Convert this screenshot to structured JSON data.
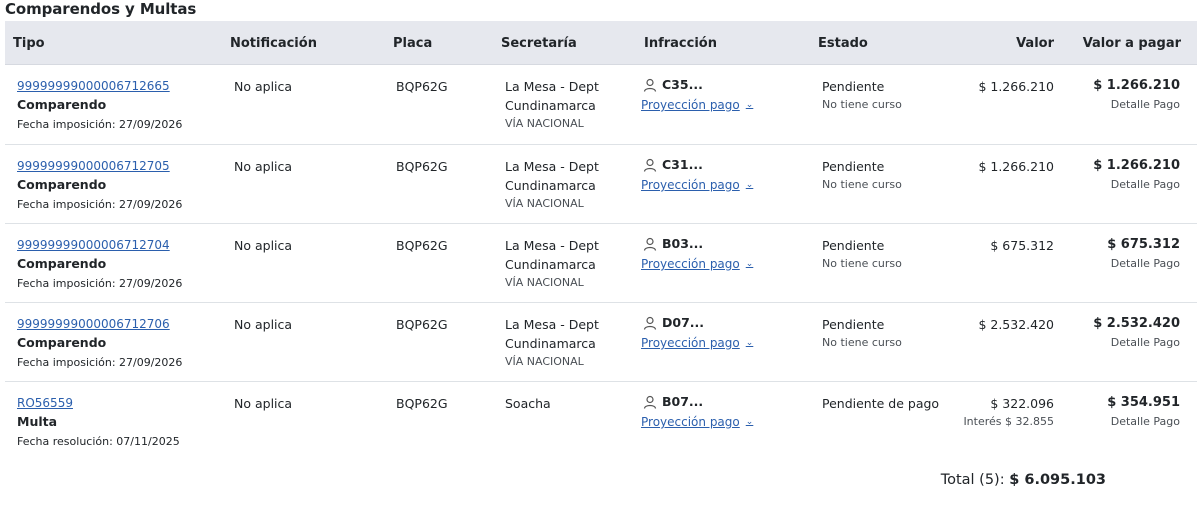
{
  "page": {
    "title": "Comparendos y Multas"
  },
  "columns": {
    "tipo": "Tipo",
    "notificacion": "Notificación",
    "placa": "Placa",
    "secretaria": "Secretaría",
    "infraccion": "Infracción",
    "estado": "Estado",
    "valor": "Valor",
    "valor_a_pagar": "Valor a pagar"
  },
  "rows": [
    {
      "id": "99999999000006712665",
      "type": "Comparendo",
      "date": "Fecha imposición: 27/09/2026",
      "notificacion": "No aplica",
      "placa": "BQP62G",
      "secretaria_1": "La Mesa - Dept",
      "secretaria_2": "Cundinamarca",
      "via": "VÍA NACIONAL",
      "infraccion": "C35...",
      "proyeccion": "Proyección pago",
      "estado": "Pendiente",
      "curso": "No tiene curso",
      "valor": "$ 1.266.210",
      "interes": "",
      "valor_pagar": "$ 1.266.210",
      "detalle": "Detalle Pago"
    },
    {
      "id": "99999999000006712705",
      "type": "Comparendo",
      "date": "Fecha imposición: 27/09/2026",
      "notificacion": "No aplica",
      "placa": "BQP62G",
      "secretaria_1": "La Mesa - Dept",
      "secretaria_2": "Cundinamarca",
      "via": "VÍA NACIONAL",
      "infraccion": "C31...",
      "proyeccion": "Proyección pago",
      "estado": "Pendiente",
      "curso": "No tiene curso",
      "valor": "$ 1.266.210",
      "interes": "",
      "valor_pagar": "$ 1.266.210",
      "detalle": "Detalle Pago"
    },
    {
      "id": "99999999000006712704",
      "type": "Comparendo",
      "date": "Fecha imposición: 27/09/2026",
      "notificacion": "No aplica",
      "placa": "BQP62G",
      "secretaria_1": "La Mesa - Dept",
      "secretaria_2": "Cundinamarca",
      "via": "VÍA NACIONAL",
      "infraccion": "B03...",
      "proyeccion": "Proyección pago",
      "estado": "Pendiente",
      "curso": "No tiene curso",
      "valor": "$ 675.312",
      "interes": "",
      "valor_pagar": "$ 675.312",
      "detalle": "Detalle Pago"
    },
    {
      "id": "99999999000006712706",
      "type": "Comparendo",
      "date": "Fecha imposición: 27/09/2026",
      "notificacion": "No aplica",
      "placa": "BQP62G",
      "secretaria_1": "La Mesa - Dept",
      "secretaria_2": "Cundinamarca",
      "via": "VÍA NACIONAL",
      "infraccion": "D07...",
      "proyeccion": "Proyección pago",
      "estado": "Pendiente",
      "curso": "No tiene curso",
      "valor": "$ 2.532.420",
      "interes": "",
      "valor_pagar": "$ 2.532.420",
      "detalle": "Detalle Pago"
    },
    {
      "id": "RO56559",
      "type": "Multa",
      "date": "Fecha resolución: 07/11/2025",
      "notificacion": "No aplica",
      "placa": "BQP62G",
      "secretaria_1": "Soacha",
      "secretaria_2": "",
      "via": "",
      "infraccion": "B07...",
      "proyeccion": "Proyección pago",
      "estado": "Pendiente de pago",
      "curso": "",
      "valor": "$ 322.096",
      "interes": "Interés $ 32.855",
      "valor_pagar": "$ 354.951",
      "detalle": "Detalle Pago"
    }
  ],
  "total": {
    "label": "Total (5):",
    "amount": "$ 6.095.103"
  },
  "icons": {
    "infraccion_icon": "user-icon",
    "proyeccion_icon": "chevron-down-icon"
  },
  "colors": {
    "link": "#2b5fad",
    "header_bg": "#e6e8ee"
  }
}
